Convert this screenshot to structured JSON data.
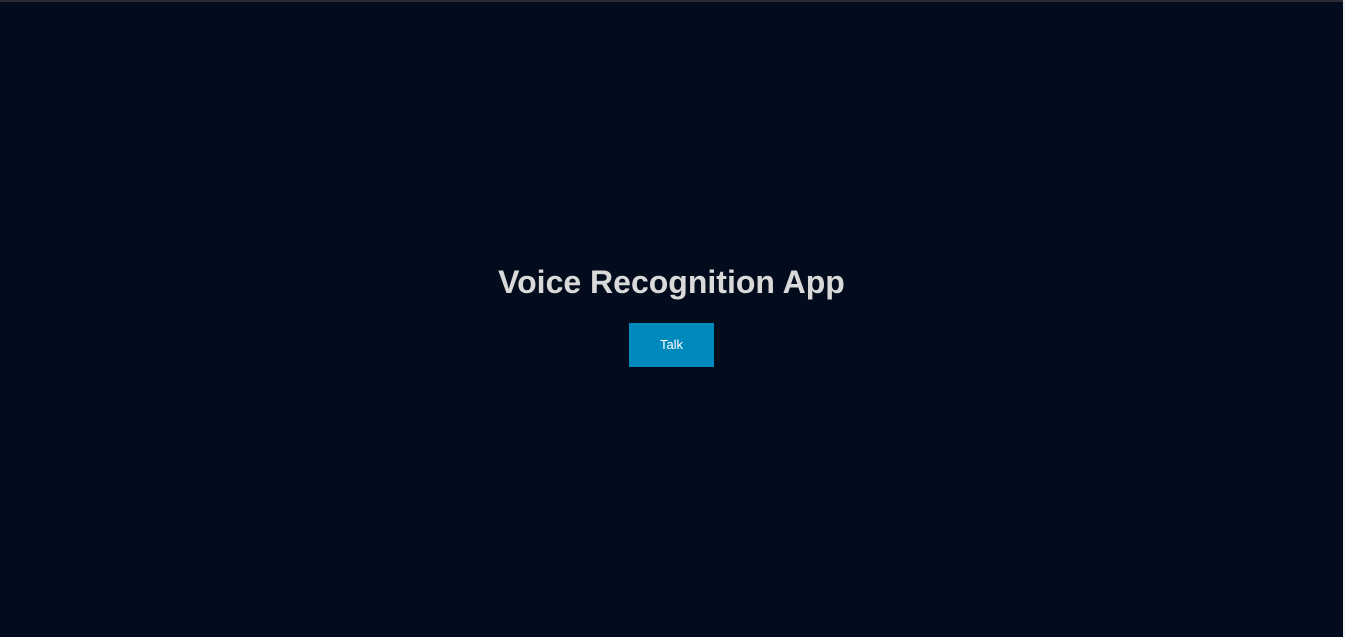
{
  "app": {
    "title": "Voice Recognition App",
    "talk_button_label": "Talk"
  },
  "colors": {
    "background": "#020c1c",
    "title_text": "#d9d9d9",
    "button_background": "#0089bd",
    "button_text": "#ffffff"
  }
}
